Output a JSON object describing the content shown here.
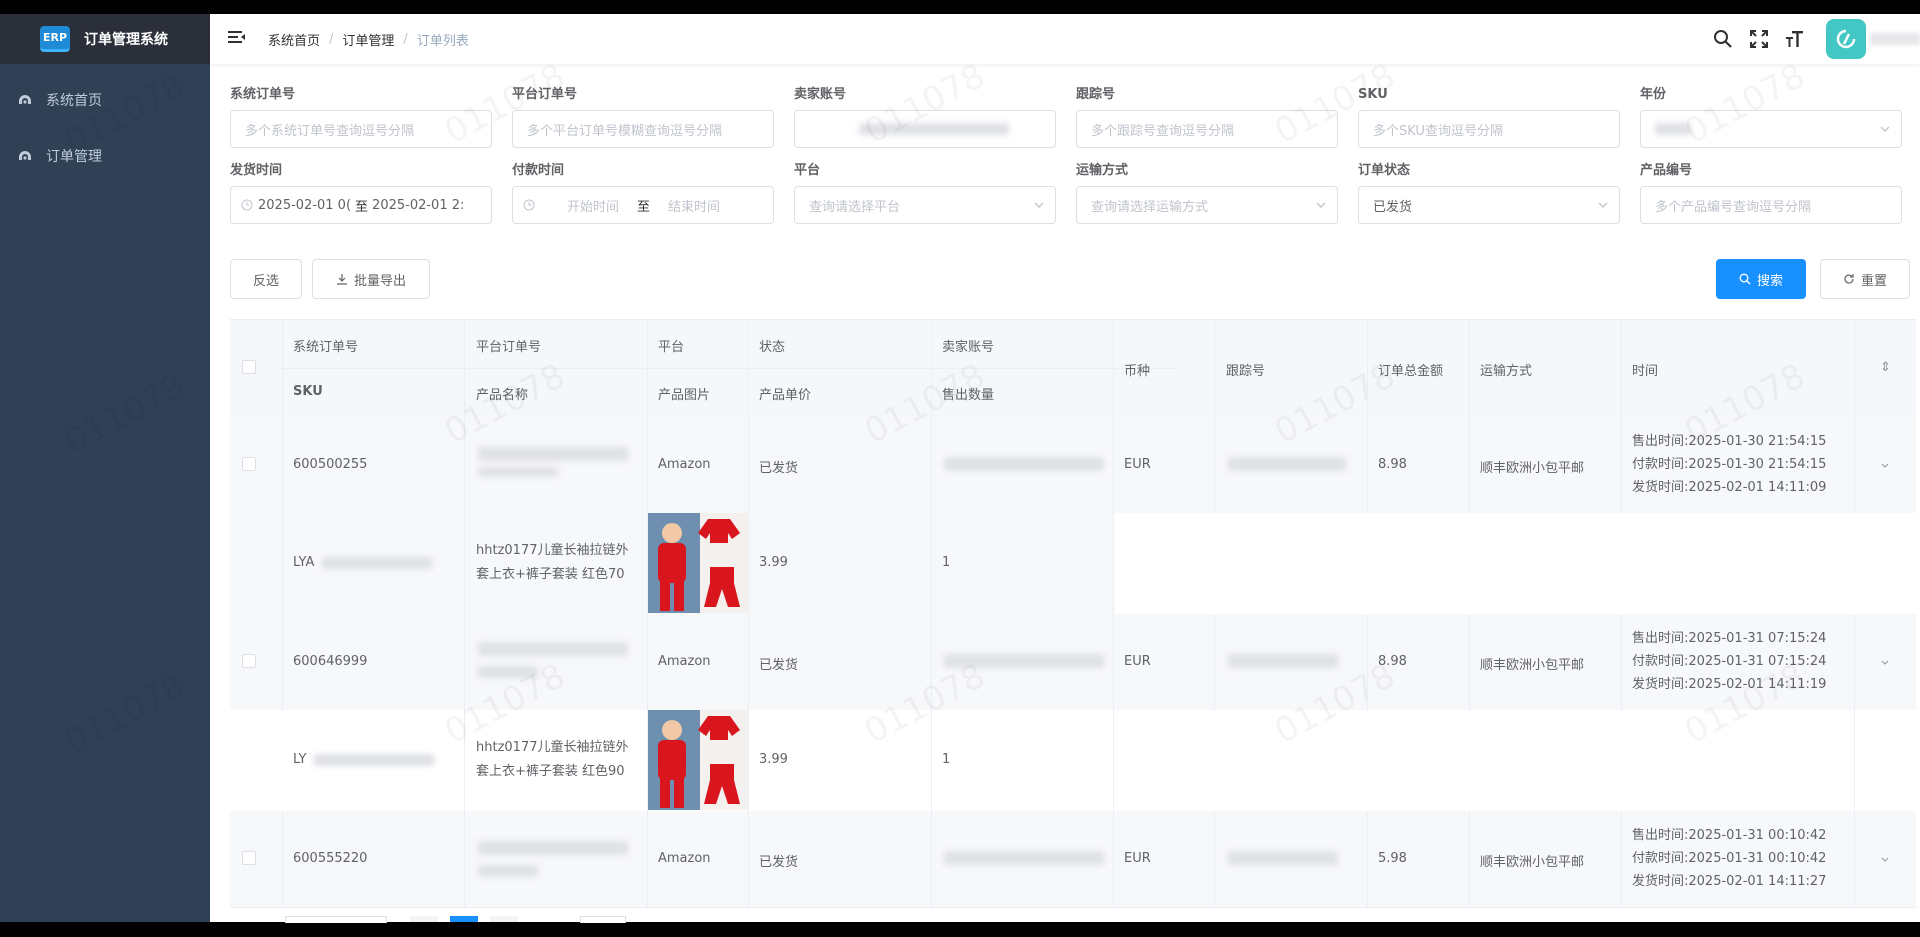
{
  "app": {
    "logo_badge": "ERP",
    "title": "订单管理系统"
  },
  "sidebar": {
    "items": [
      {
        "label": "系统首页"
      },
      {
        "label": "订单管理"
      }
    ]
  },
  "breadcrumb": {
    "home": "系统首页",
    "section": "订单管理",
    "current": "订单列表",
    "separator": "/"
  },
  "filters": {
    "sys_order": {
      "label": "系统订单号",
      "placeholder": "多个系统订单号查询逗号分隔"
    },
    "platform_order": {
      "label": "平台订单号",
      "placeholder": "多个平台订单号模糊查询逗号分隔"
    },
    "seller_account": {
      "label": "卖家账号"
    },
    "tracking_no": {
      "label": "跟踪号",
      "placeholder": "多个跟踪号查询逗号分隔"
    },
    "sku": {
      "label": "SKU",
      "placeholder": "多个SKU查询逗号分隔"
    },
    "year": {
      "label": "年份"
    },
    "ship_time": {
      "label": "发货时间",
      "start": "2025-02-01 0(",
      "sep": "至",
      "end": "2025-02-01 2:"
    },
    "pay_time": {
      "label": "付款时间",
      "start_placeholder": "开始时间",
      "sep": "至",
      "end_placeholder": "结束时间"
    },
    "platform": {
      "label": "平台",
      "placeholder": "查询请选择平台"
    },
    "shipping_method": {
      "label": "运输方式",
      "placeholder": "查询请选择运输方式"
    },
    "order_status": {
      "label": "订单状态",
      "value": "已发货"
    },
    "product_code": {
      "label": "产品编号",
      "placeholder": "多个产品编号查询逗号分隔"
    }
  },
  "buttons": {
    "invert_select": "反选",
    "batch_export": "批量导出",
    "search": "搜索",
    "reset": "重置"
  },
  "table": {
    "headers": {
      "sys_order": "系统订单号",
      "platform_order": "平台订单号",
      "platform": "平台",
      "status": "状态",
      "seller": "卖家账号",
      "sku": "SKU",
      "product_name": "产品名称",
      "product_image": "产品图片",
      "unit_price": "产品单价",
      "qty_sold": "售出数量",
      "currency": "币种",
      "tracking": "跟踪号",
      "total": "订单总金额",
      "shipping": "运输方式",
      "time": "时间",
      "sort": "⇕"
    },
    "orders": [
      {
        "sys_order": "600500255",
        "platform": "Amazon",
        "status": "已发货",
        "currency": "EUR",
        "total": "8.98",
        "shipping": "顺丰欧洲小包平邮",
        "sold_time": "售出时间:2025-01-30 21:54:15",
        "pay_time": "付款时间:2025-01-30 21:54:15",
        "ship_time": "发货时间:2025-02-01 14:11:09",
        "sku": "LYA",
        "product_name_1": "hhtz0177儿童长袖拉链外",
        "product_name_2": "套上衣+裤子套装 红色70",
        "unit_price": "3.99",
        "qty": "1"
      },
      {
        "sys_order": "600646999",
        "platform": "Amazon",
        "status": "已发货",
        "currency": "EUR",
        "total": "8.98",
        "shipping": "顺丰欧洲小包平邮",
        "sold_time": "售出时间:2025-01-31 07:15:24",
        "pay_time": "付款时间:2025-01-31 07:15:24",
        "ship_time": "发货时间:2025-02-01 14:11:19",
        "sku": "LY",
        "product_name_1": "hhtz0177儿童长袖拉链外",
        "product_name_2": "套上衣+裤子套装 红色90",
        "unit_price": "3.99",
        "qty": "1"
      },
      {
        "sys_order": "600555220",
        "platform": "Amazon",
        "status": "已发货",
        "currency": "EUR",
        "total": "5.98",
        "shipping": "顺丰欧洲小包平邮",
        "sold_time": "售出时间:2025-01-31 00:10:42",
        "pay_time": "付款时间:2025-01-31 00:10:42",
        "ship_time": "发货时间:2025-02-01 14:11:27"
      }
    ]
  },
  "watermark": "011078",
  "colors": {
    "sidebar": "#304156",
    "logo_bar": "#2b2f3a",
    "primary": "#1890ff",
    "avatar": "#43c7c4",
    "product_red": "#d9161e"
  }
}
